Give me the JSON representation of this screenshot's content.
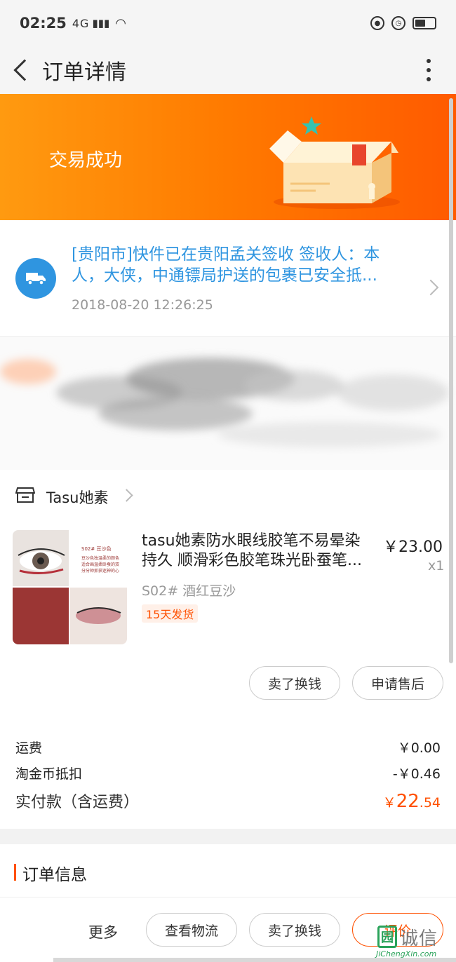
{
  "status_bar": {
    "time": "02:25",
    "network": "4G"
  },
  "nav": {
    "title": "订单详情"
  },
  "banner": {
    "status": "交易成功"
  },
  "logistics": {
    "message": "[贵阳市]快件已在贵阳孟关签收 签收人：本人，大侠，中通镖局护送的包裹已安全抵...",
    "time": "2018-08-20 12:26:25"
  },
  "shop": {
    "name": "Tasu她素"
  },
  "product": {
    "title": "tasu她素防水眼线胶笔不易晕染持久 顺滑彩色胶笔珠光卧蚕笔...",
    "price": "￥23.00",
    "quantity": "x1",
    "sku": "S02# 酒红豆沙",
    "shipping_badge": "15天发货",
    "thumb_caption": "S02# 豆沙色",
    "thumb_desc": "豆沙色独温柔的颜色 适合画温柔卧蚕的双 分分钟抓获迷神的心"
  },
  "item_actions": {
    "sell_label": "卖了换钱",
    "after_sale_label": "申请售后"
  },
  "fees": {
    "shipping_label": "运费",
    "shipping_value": "￥0.00",
    "coin_label": "淘金币抵扣",
    "coin_value": "-￥0.46",
    "paid_label": "实付款（含运费）",
    "paid_currency": "￥",
    "paid_int": "22",
    "paid_dec": ".54"
  },
  "order_info": {
    "title": "订单信息"
  },
  "bottom_bar": {
    "more_label": "更多",
    "logistics_label": "查看物流",
    "sell_label": "卖了换钱",
    "rate_label": "评价"
  },
  "watermark": {
    "logo_char": "园",
    "text": "诚信",
    "url": "JiChengXin.com"
  },
  "colors": {
    "accent": "#ff5000",
    "link_blue": "#2f95e0",
    "banner_start": "#ff9a10",
    "banner_end": "#ff5a00"
  }
}
